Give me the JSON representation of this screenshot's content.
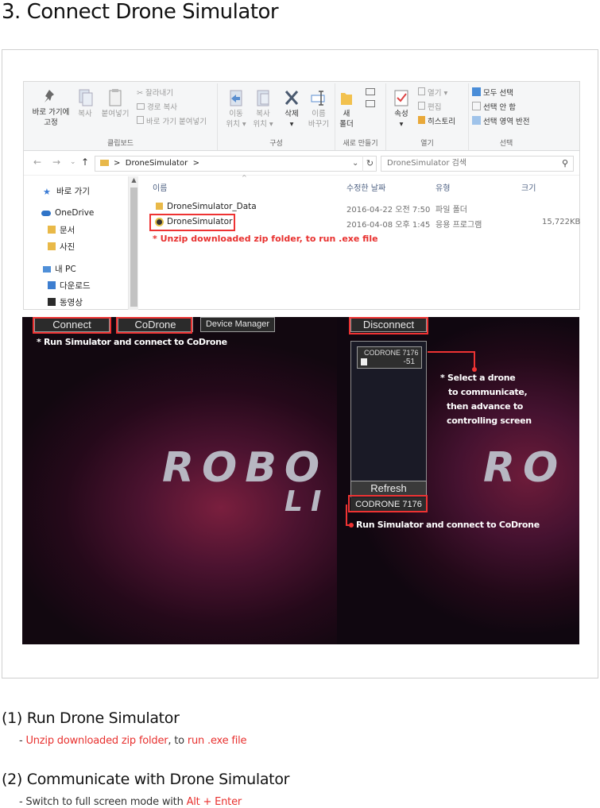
{
  "page": {
    "title": "3. Connect Drone Simulator"
  },
  "explorer": {
    "ribbon": {
      "clipboard": {
        "pin_label_1": "바로 가기에",
        "pin_label_2": "고정",
        "copy": "복사",
        "paste": "붙여넣기",
        "cut": "잘라내기",
        "copy_path": "경로 복사",
        "paste_shortcut": "바로 가기 붙여넣기",
        "group": "클립보드"
      },
      "organize": {
        "move_1": "이동",
        "move_2": "위치",
        "copy_1": "복사",
        "copy_2": "위치",
        "delete": "삭제",
        "rename_1": "이름",
        "rename_2": "바꾸기",
        "group": "구성"
      },
      "new": {
        "folder_1": "새",
        "folder_2": "폴더",
        "group": "새로 만들기"
      },
      "open": {
        "properties": "속성",
        "open": "열기",
        "edit": "편집",
        "history": "히스토리",
        "group": "열기"
      },
      "select": {
        "select_all": "모두 선택",
        "select_none": "선택 안 함",
        "invert": "선택 영역 반전",
        "group": "선택"
      }
    },
    "address": {
      "path": "DroneSimulator",
      "separator": ">",
      "search_placeholder": "DroneSimulator 검색"
    },
    "nav": {
      "quick_access": "바로 가기",
      "onedrive": "OneDrive",
      "documents": "문서",
      "pictures": "사진",
      "this_pc": "내 PC",
      "downloads": "다운로드",
      "videos": "동영상"
    },
    "columns": {
      "name": "이름",
      "modified": "수정한 날짜",
      "type": "유형",
      "size": "크기"
    },
    "files": [
      {
        "name": "DroneSimulator_Data",
        "modified": "2016-04-22 오전 7:50",
        "type": "파일 폴더",
        "size": ""
      },
      {
        "name": "DroneSimulator",
        "modified": "2016-04-08 오후 1:45",
        "type": "응용 프로그램",
        "size": "15,722KB"
      }
    ],
    "note": "* Unzip downloaded zip folder, to run .exe file"
  },
  "simulator": {
    "left": {
      "connect": "Connect",
      "codrone": "CoDrone",
      "device_manager": "Device Manager",
      "note": "* Run Simulator and connect to CoDrone",
      "logo_line1": "ROBO",
      "logo_line2": "LI"
    },
    "right": {
      "disconnect": "Disconnect",
      "drone_name": "CODRONE 7176",
      "drone_rssi": "-51",
      "refresh": "Refresh",
      "status": "CODRONE 7176",
      "note_select_1": "* Select a drone",
      "note_select_2": "to communicate,",
      "note_select_3": "then advance to",
      "note_select_4": "controlling screen",
      "note_connect": "Run Simulator and connect to CoDrone",
      "logo": "RO"
    }
  },
  "steps": [
    {
      "title": "(1) Run Drone Simulator",
      "dash": "- ",
      "red1": "Unzip downloaded zip folder",
      "mid": ", to ",
      "red2": "run .exe file"
    },
    {
      "title": "(2) Communicate with Drone Simulator",
      "dash": "- Switch to full screen mode with ",
      "red1": "Alt + Enter"
    }
  ]
}
